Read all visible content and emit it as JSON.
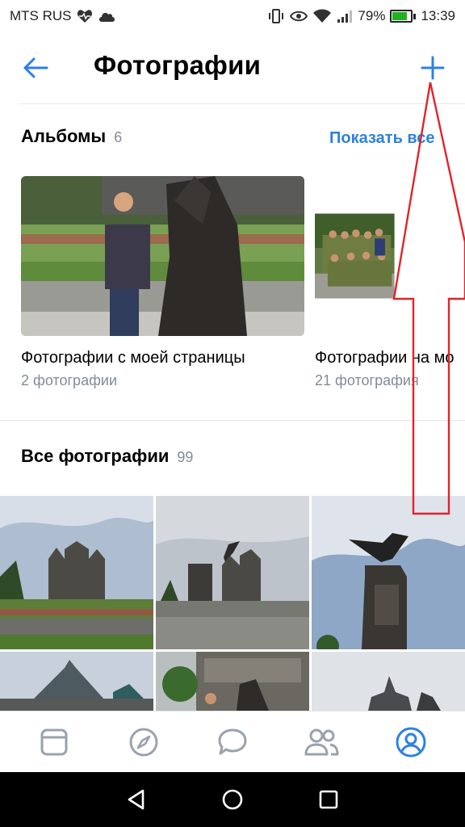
{
  "status_bar": {
    "carrier": "MTS RUS",
    "battery": "79%",
    "battery_level": 0.79,
    "time": "13:39"
  },
  "header": {
    "title": "Фотографии",
    "back_icon": "arrow-left-icon",
    "add_icon": "plus-icon"
  },
  "albums": {
    "title": "Альбомы",
    "count": "6",
    "show_all": "Показать все",
    "items": [
      {
        "name": "Фотографии с моей страницы",
        "count": "2 фотографии"
      },
      {
        "name": "Фотографии на мо",
        "count": "21 фотография"
      }
    ]
  },
  "all_photos": {
    "title": "Все фотографии",
    "count": "99"
  },
  "tab_bar": {
    "items": [
      "feed-icon",
      "explore-icon",
      "messages-icon",
      "friends-icon",
      "profile-icon"
    ],
    "active": "profile-icon"
  },
  "nav_bar": [
    "back-triangle-icon",
    "home-circle-icon",
    "recents-square-icon"
  ],
  "colors": {
    "accent": "#2d81e0",
    "secondary_text": "#818c99",
    "annotation": "#e0242c"
  }
}
